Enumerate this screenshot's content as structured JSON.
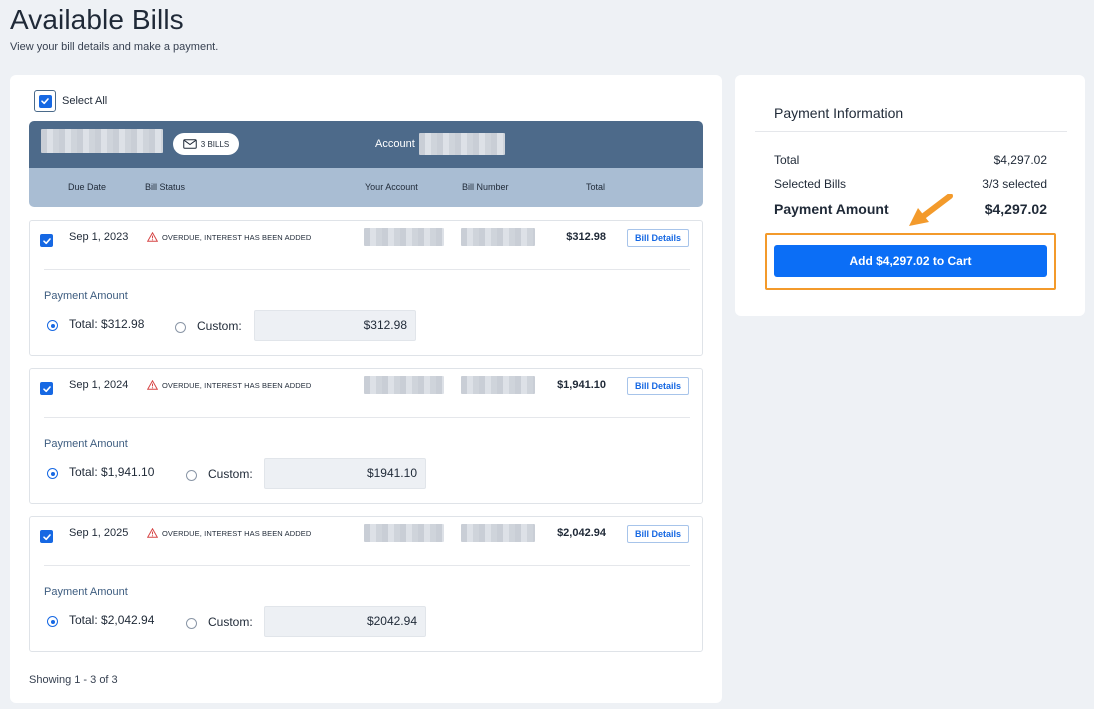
{
  "page": {
    "title": "Available Bills",
    "subtitle": "View your bill details and make a payment."
  },
  "bills_panel": {
    "select_all_label": "Select All",
    "account_header": {
      "badge_label": "3 BILLS",
      "account_label": "Account"
    },
    "columns": [
      "Due Date",
      "Bill Status",
      "Your Account",
      "Bill Number",
      "Total"
    ],
    "bills": [
      {
        "due_date": "Sep 1, 2023",
        "status": "OVERDUE, INTEREST HAS BEEN ADDED",
        "total": "$312.98",
        "details_label": "Bill Details",
        "payment_amount_label": "Payment Amount",
        "total_option": "Total:  $312.98",
        "custom_label": "Custom:",
        "custom_value": "$312.98",
        "selected": true
      },
      {
        "due_date": "Sep 1, 2024",
        "status": "OVERDUE, INTEREST HAS BEEN ADDED",
        "total": "$1,941.10",
        "details_label": "Bill Details",
        "payment_amount_label": "Payment Amount",
        "total_option": "Total:  $1,941.10",
        "custom_label": "Custom:",
        "custom_value": "$1941.10",
        "selected": true
      },
      {
        "due_date": "Sep 1, 2025",
        "status": "OVERDUE, INTEREST HAS BEEN ADDED",
        "total": "$2,042.94",
        "details_label": "Bill Details",
        "payment_amount_label": "Payment Amount",
        "total_option": "Total:  $2,042.94",
        "custom_label": "Custom:",
        "custom_value": "$2042.94",
        "selected": true
      }
    ],
    "showing": "Showing 1 - 3 of 3"
  },
  "payment_info": {
    "title": "Payment Information",
    "total_label": "Total",
    "total_value": "$4,297.02",
    "selected_label": "Selected Bills",
    "selected_value": "3/3 selected",
    "payment_amount_label": "Payment Amount",
    "payment_amount_value": "$4,297.02",
    "add_to_cart_label": "Add $4,297.02 to Cart"
  },
  "colors": {
    "accent": "#1668e3",
    "header": "#4d6a8a",
    "subheader": "#a9bdd3",
    "highlight": "#f39a2b",
    "warning": "#d64545"
  }
}
